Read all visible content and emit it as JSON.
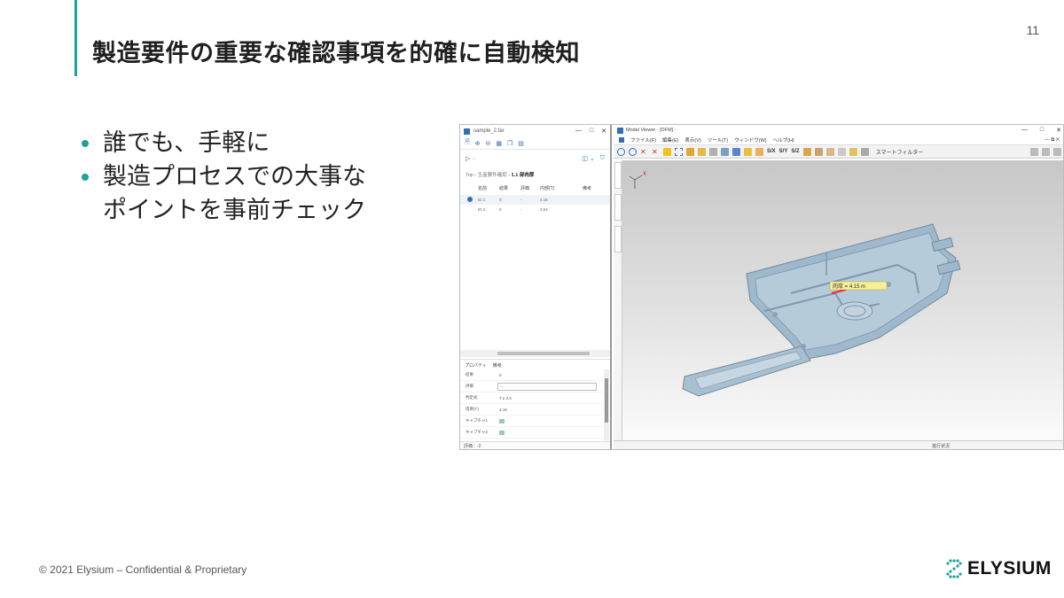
{
  "slide": {
    "title": "製造要件の重要な確認事項を的確に自動検知",
    "page_number": "11",
    "footer": "© 2021 Elysium – Confidential & Proprietary",
    "logo_text": "ELYSIUM",
    "accent_color": "#1aa39a"
  },
  "bullets": [
    "誰でも、手軽に",
    "製造プロセスでの大事なポイントを事前チェック"
  ],
  "bullet_lines": {
    "b2_line1": "製造プロセスでの大事な",
    "b2_line2": "ポイントを事前チェック"
  },
  "screenshot": {
    "left_window": {
      "title": "sample_2.far",
      "breadcrumb_root": "Top",
      "breadcrumb_mid": "生産要件確認",
      "breadcrumb_current": "1.1 部肉厚",
      "columns": [
        "名前",
        "結果",
        "評価",
        "内部(T)",
        "備考"
      ],
      "rows": [
        {
          "name": "ID 1",
          "result": "0",
          "eval": "-",
          "value": "4.15",
          "note": ""
        },
        {
          "name": "ID 2",
          "result": "0",
          "eval": "-",
          "value": "3.54",
          "note": ""
        }
      ],
      "prop_tabs": [
        "プロパティ",
        "備考"
      ],
      "props": [
        {
          "key": "結果",
          "value": "0"
        },
        {
          "key": "評価",
          "value": "--"
        },
        {
          "key": "判定式",
          "value": "T ≥ 3.5"
        },
        {
          "key": "肉厚(T)",
          "value": "4.15"
        },
        {
          "key": "キャプチャ1",
          "value": ""
        },
        {
          "key": "キャプチャ2",
          "value": ""
        }
      ],
      "status": "評価：-2"
    },
    "right_window": {
      "title": "Model Viewer - [DFM] -",
      "menu": [
        "ファイル(F)",
        "編集(E)",
        "表示(V)",
        "ツール(T)",
        "ウィンドウ(W)",
        "ヘルプ(H)"
      ],
      "toolbar_labels": [
        "S/X",
        "S/Y",
        "S/Z"
      ],
      "filter_label": "スマートフィルター",
      "measure_label": "肉厚 = 4.15 m",
      "axis_label": "X",
      "status": "進行状況"
    }
  }
}
